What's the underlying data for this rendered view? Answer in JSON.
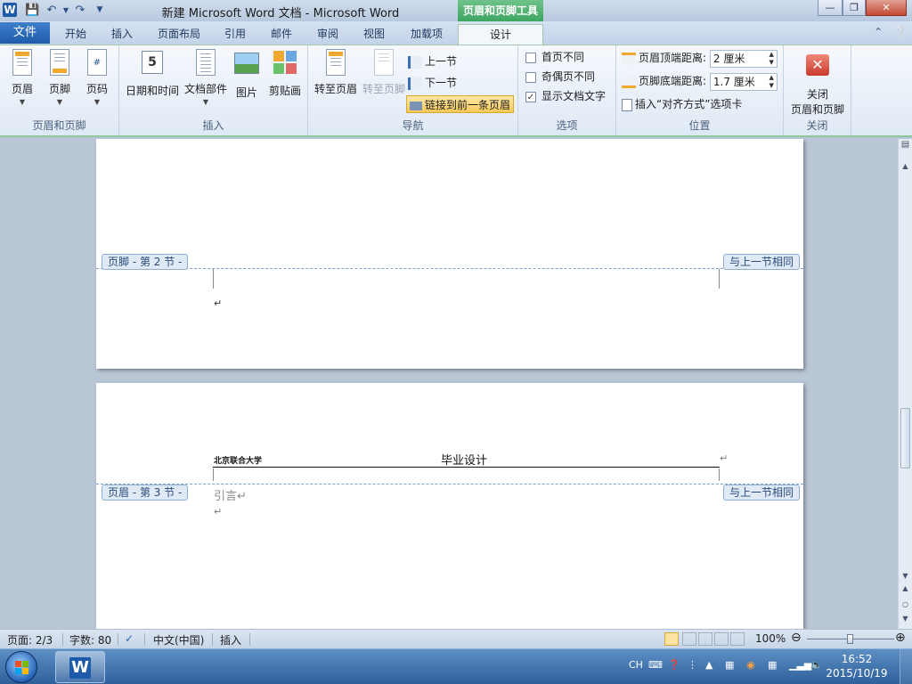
{
  "window": {
    "title": "新建 Microsoft Word 文档 - Microsoft Word",
    "context_tools": "页眉和页脚工具",
    "minimize": "—",
    "restore": "❐",
    "close": "✕"
  },
  "tabs": {
    "file": "文件",
    "items": [
      "开始",
      "插入",
      "页面布局",
      "引用",
      "邮件",
      "审阅",
      "视图",
      "加载项",
      "设计"
    ],
    "active": "设计"
  },
  "ribbon": {
    "group_header_footer": {
      "label": "页眉和页脚",
      "header": "页眉",
      "footer": "页脚",
      "page_number": "页码"
    },
    "group_insert": {
      "label": "插入",
      "date_time": "日期和时间",
      "quick_parts": "文档部件",
      "picture": "图片",
      "clip_art": "剪贴画"
    },
    "group_navigation": {
      "label": "导航",
      "goto_header": "转至页眉",
      "goto_footer": "转至页脚",
      "prev_section": "上一节",
      "next_section": "下一节",
      "link_previous": "链接到前一条页眉"
    },
    "group_options": {
      "label": "选项",
      "different_first": "首页不同",
      "different_first_checked": false,
      "different_odd_even": "奇偶页不同",
      "different_odd_even_checked": false,
      "show_doc_text": "显示文档文字",
      "show_doc_text_checked": true
    },
    "group_position": {
      "label": "位置",
      "header_from_top_label": "页眉顶端距离:",
      "header_from_top_value": "2 厘米",
      "footer_from_bottom_label": "页脚底端距离:",
      "footer_from_bottom_value": "1.7 厘米",
      "insert_align_tab": "插入“对齐方式”选项卡"
    },
    "group_close": {
      "label": "关闭",
      "close_line1": "关闭",
      "close_line2": "页眉和页脚"
    }
  },
  "document": {
    "page2": {
      "footer_tag": "页脚 - 第 2 节 -",
      "same_as_prev": "与上一节相同",
      "cursor_mark": "↵"
    },
    "page3": {
      "header_left": "北京联合大学",
      "header_center": "毕业设计",
      "header_para_mark": "↵",
      "header_tag": "页眉 - 第 3 节 -",
      "same_as_prev": "与上一节相同",
      "body_line1": "引言↵",
      "body_line2": "↵"
    }
  },
  "statusbar": {
    "page": "页面: 2/3",
    "words": "字数: 80",
    "language": "中文(中国)",
    "mode": "插入",
    "zoom": "100%",
    "zoom_level": 1.0
  },
  "taskbar": {
    "ime": "CH",
    "time": "16:52",
    "date": "2015/10/19"
  }
}
